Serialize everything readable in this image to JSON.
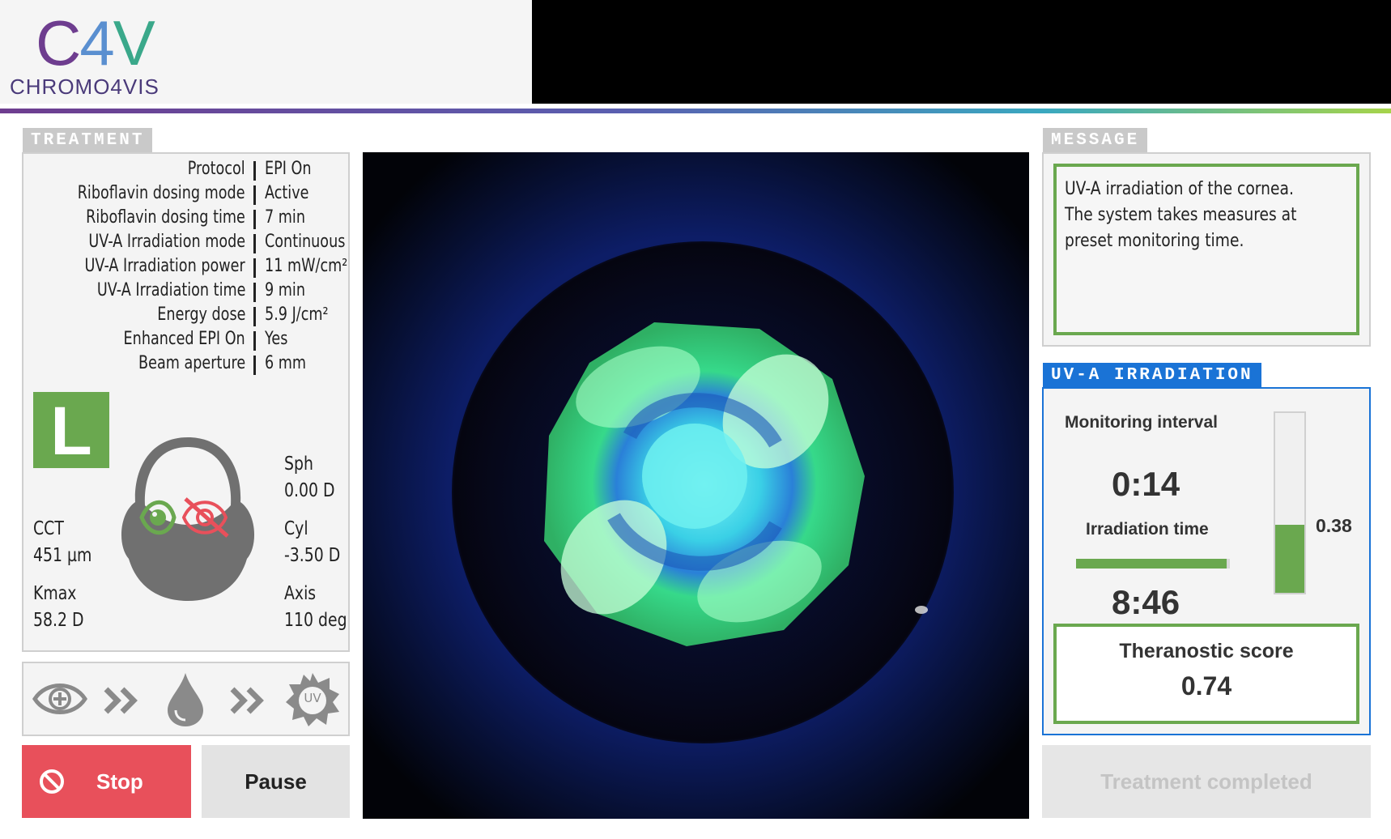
{
  "header": {
    "logo_mark": [
      "C",
      "4",
      "V"
    ],
    "logo_text": "CHROMO4VIS"
  },
  "treatment": {
    "tab_label": "TREATMENT",
    "rows": [
      {
        "label": "Protocol",
        "value": "EPI On"
      },
      {
        "label": "Riboflavin dosing mode",
        "value": "Active"
      },
      {
        "label": "Riboflavin dosing time",
        "value": "7 min"
      },
      {
        "label": "UV-A Irradiation mode",
        "value": "Continuous"
      },
      {
        "label": "UV-A Irradiation power",
        "value": "11 mW/cm²"
      },
      {
        "label": "UV-A Irradiation time",
        "value": "9 min"
      },
      {
        "label": "Energy dose",
        "value": "5.9 J/cm²"
      },
      {
        "label": "Enhanced EPI On",
        "value": "Yes"
      },
      {
        "label": "Beam aperture",
        "value": "6 mm"
      }
    ],
    "eye_badge": "L",
    "cct_label": "CCT",
    "cct_value": "451 µm",
    "kmax_label": "Kmax",
    "kmax_value": "58.2 D",
    "sph_label": "Sph",
    "sph_value": "0.00 D",
    "cyl_label": "Cyl",
    "cyl_value": "-3.50 D",
    "axis_label": "Axis",
    "axis_value": "110 deg"
  },
  "steps": {
    "uv_label": "UV",
    "icons": [
      "eye-plus-icon",
      "double-chevron-icon",
      "drop-icon",
      "double-chevron-icon",
      "uv-sun-icon"
    ]
  },
  "controls": {
    "stop_label": "Stop",
    "pause_label": "Pause",
    "completed_label": "Treatment completed"
  },
  "message": {
    "tab_label": "MESSAGE",
    "text_lines": [
      "UV-A irradiation of the cornea.",
      "The system takes measures at",
      "preset monitoring time."
    ]
  },
  "uva": {
    "tab_label": "UV-A IRRADIATION",
    "monitoring_label": "Monitoring interval",
    "monitoring_value": "0:14",
    "irradiation_label": "Irradiation time",
    "irradiation_value": "8:46",
    "irradiation_progress": 0.98,
    "level_value": "0.38",
    "level_fraction": 0.38,
    "theranostic_label": "Theranostic score",
    "theranostic_value": "0.74"
  },
  "colors": {
    "accent_green": "#6aa84f",
    "stop_red": "#e8505b",
    "uva_blue": "#1a73d6"
  }
}
